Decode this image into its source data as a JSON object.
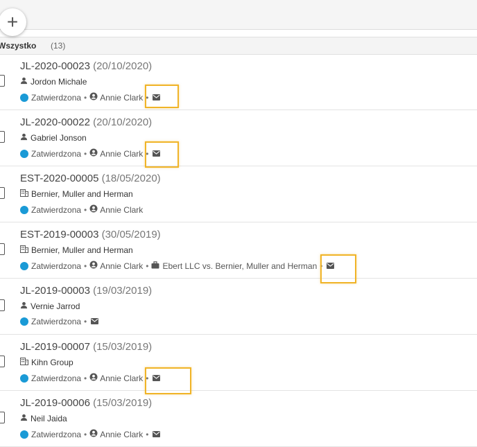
{
  "toolbar": {
    "add_symbol": "+"
  },
  "filter": {
    "label": "Wszystko",
    "count": "(13)"
  },
  "colors": {
    "status": "#1a9ad6",
    "highlight": "#f0b428"
  },
  "rows": [
    {
      "number": "JL-2020-00023",
      "date": "(20/10/2020)",
      "party": "Jordon Michale",
      "party_type": "person",
      "status": "Zatwierdzona",
      "owner": "Annie Clark",
      "case": "",
      "has_mail": true
    },
    {
      "number": "JL-2020-00022",
      "date": "(20/10/2020)",
      "party": "Gabriel Jonson",
      "party_type": "person",
      "status": "Zatwierdzona",
      "owner": "Annie Clark",
      "case": "",
      "has_mail": true
    },
    {
      "number": "EST-2020-00005",
      "date": "(18/05/2020)",
      "party": "Bernier, Muller and Herman",
      "party_type": "company",
      "status": "Zatwierdzona",
      "owner": "Annie Clark",
      "case": "",
      "has_mail": false
    },
    {
      "number": "EST-2019-00003",
      "date": "(30/05/2019)",
      "party": "Bernier, Muller and Herman",
      "party_type": "company",
      "status": "Zatwierdzona",
      "owner": "Annie Clark",
      "case": "Ebert LLC vs. Bernier, Muller and Herman",
      "has_mail": true
    },
    {
      "number": "JL-2019-00003",
      "date": "(19/03/2019)",
      "party": "Vernie Jarrod",
      "party_type": "person",
      "status": "Zatwierdzona",
      "owner": "",
      "case": "",
      "has_mail": true
    },
    {
      "number": "JL-2019-00007",
      "date": "(15/03/2019)",
      "party": "Kihn Group",
      "party_type": "company",
      "status": "Zatwierdzona",
      "owner": "Annie Clark",
      "case": "",
      "has_mail": true
    },
    {
      "number": "JL-2019-00006",
      "date": "(15/03/2019)",
      "party": "Neil Jaida",
      "party_type": "person",
      "status": "Zatwierdzona",
      "owner": "Annie Clark",
      "case": "",
      "has_mail": true
    }
  ]
}
